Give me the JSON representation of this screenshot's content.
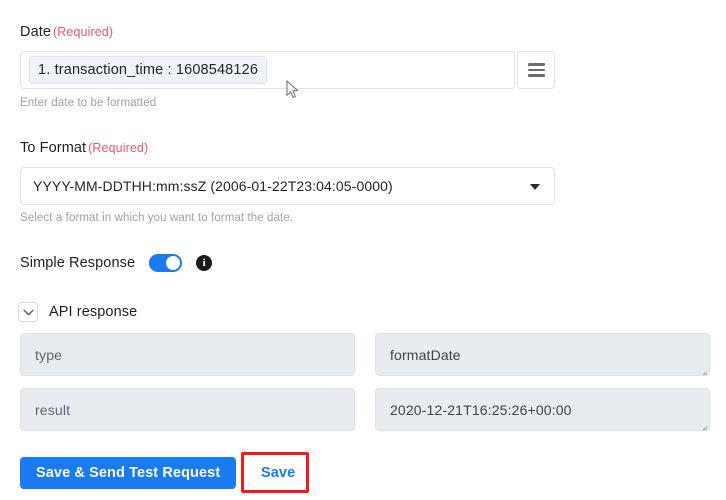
{
  "form": {
    "date_field": {
      "label": "Date",
      "required_text": "(Required)",
      "token_value": "1. transaction_time : 1608548126",
      "helper_text": "Enter date to be formatted",
      "menu_icon": "hamburger-menu-icon"
    },
    "to_format_field": {
      "label": "To Format",
      "required_text": "(Required)",
      "selected_value": "YYYY-MM-DDTHH:mm:ssZ (2006-01-22T23:04:05-0000)",
      "helper_text": "Select a format in which you want to format the date.",
      "caret_icon": "chevron-down-icon"
    },
    "simple_response": {
      "label": "Simple Response",
      "toggle_state": "on",
      "info_icon": "info-icon",
      "info_glyph": "i"
    }
  },
  "api_response": {
    "title": "API response",
    "expand_icon": "chevron-down-icon",
    "rows": [
      {
        "key": "type",
        "value": "formatDate"
      },
      {
        "key": "result",
        "value": "2020-12-21T16:25:26+00:00"
      }
    ]
  },
  "actions": {
    "primary_label": "Save & Send Test Request",
    "secondary_label": "Save"
  },
  "colors": {
    "accent_blue": "#1a7af0",
    "required_red": "#ea5a6e",
    "highlight_red": "#ee1c1c",
    "readonly_field_bg": "#e8ecf0",
    "token_chip_bg": "#eef3fa"
  }
}
